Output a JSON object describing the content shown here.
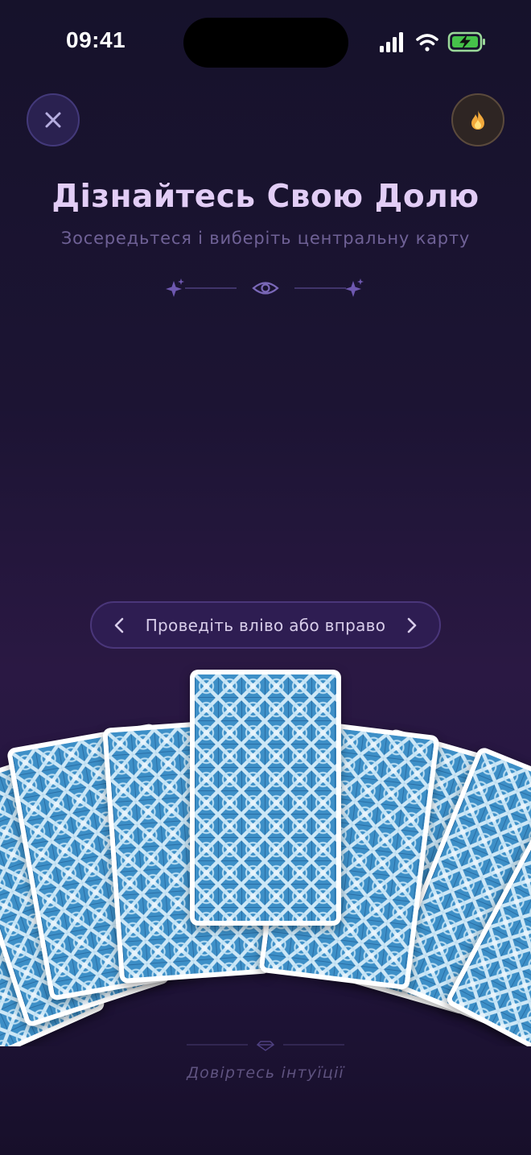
{
  "status_bar": {
    "time": "09:41",
    "icons": [
      "signal-icon",
      "wifi-icon",
      "battery-charging-icon"
    ]
  },
  "header": {
    "close_icon": "close-icon",
    "streak_icon": "flame-icon",
    "title": "Дізнайтесь Свою Долю",
    "subtitle": "Зосередьтеся і виберіть центральну карту",
    "divider_icons": [
      "sparkle-icon",
      "eye-icon",
      "sparkle-icon"
    ]
  },
  "swipe_hint": {
    "label": "Проведіть вліво або вправо",
    "left_icon": "chevron-left-icon",
    "right_icon": "chevron-right-icon"
  },
  "cards": {
    "count_visible": 8,
    "selected_index": 3,
    "back_design": "blue-ornamental-tile"
  },
  "footer": {
    "icon": "gem-icon",
    "text": "Довіртесь інтуїції"
  },
  "colors": {
    "title": "#e2cdf6",
    "subtitle": "#6f6196",
    "accent": "#4a367a",
    "card_back": "#3d8fc7"
  }
}
